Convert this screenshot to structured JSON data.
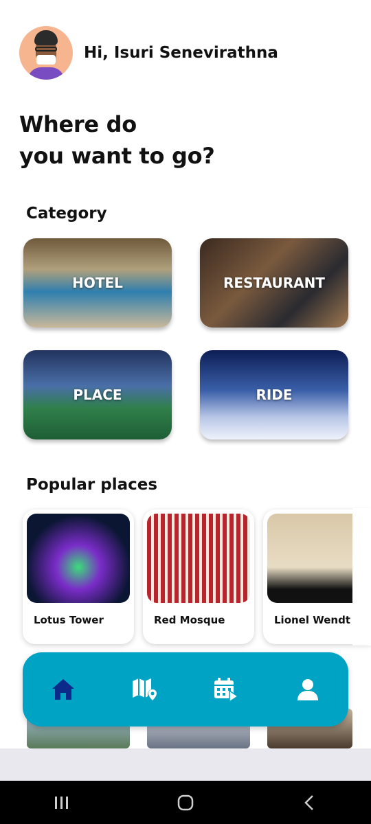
{
  "header": {
    "greeting": "Hi, Isuri Senevirathna"
  },
  "headline": {
    "line1": "Where do",
    "line2": "you want to go?"
  },
  "category": {
    "title": "Category",
    "items": [
      {
        "label": "HOTEL"
      },
      {
        "label": "RESTAURANT"
      },
      {
        "label": "PLACE"
      },
      {
        "label": "RIDE"
      }
    ]
  },
  "popular": {
    "title": "Popular places",
    "items": [
      {
        "name": "Lotus Tower"
      },
      {
        "name": "Red Mosque"
      },
      {
        "name": "Lionel Wendt A"
      }
    ]
  },
  "nav": {
    "items": [
      {
        "icon": "home-icon",
        "active": true
      },
      {
        "icon": "map-icon",
        "active": false
      },
      {
        "icon": "calendar-icon",
        "active": false
      },
      {
        "icon": "profile-icon",
        "active": false
      }
    ],
    "colors": {
      "bar": "#00a3c4",
      "active": "#0b2a8a",
      "inactive": "#ffffff"
    }
  },
  "system_nav": {
    "icons": [
      "recents-icon",
      "home-circle-icon",
      "back-icon"
    ]
  }
}
